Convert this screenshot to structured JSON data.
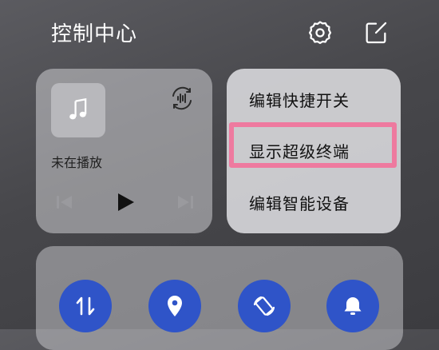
{
  "header": {
    "title": "控制中心",
    "icons": [
      "gear-icon",
      "edit-icon"
    ]
  },
  "media": {
    "status": "未在播放",
    "icons": [
      "music-note-icon",
      "audio-output-icon",
      "previous-icon",
      "play-icon",
      "next-icon"
    ]
  },
  "menu": {
    "items": [
      "编辑快捷开关",
      "显示超级终端",
      "编辑智能设备"
    ],
    "highlighted_index": 1,
    "highlight_color": "#ee7a9f"
  },
  "toggles": {
    "icons": [
      "data-transfer-icon",
      "location-icon",
      "auto-rotate-icon",
      "bell-icon"
    ],
    "accent_color": "#2f54c8"
  }
}
